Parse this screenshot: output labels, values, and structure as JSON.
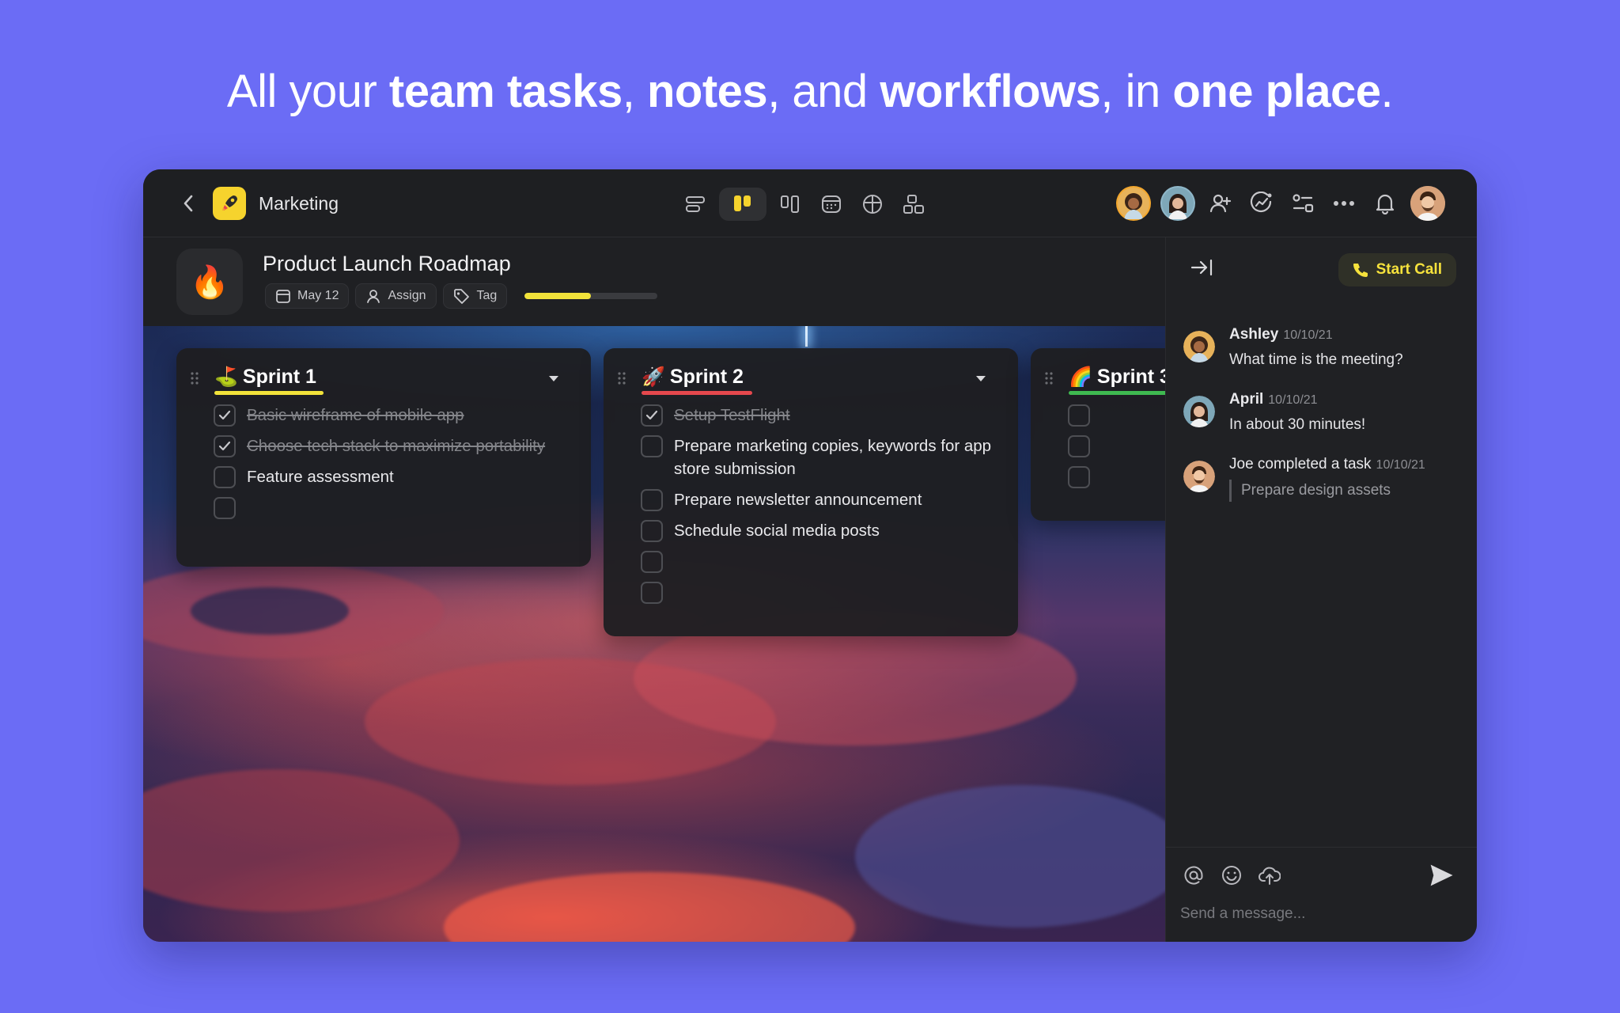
{
  "headline": {
    "p1": "All your ",
    "b1": "team tasks",
    "p2": ", ",
    "b2": "notes",
    "p3": ", and ",
    "b3": "workflows",
    "p4": ", in ",
    "b4": "one place",
    "p5": "."
  },
  "topbar": {
    "workspace": "Marketing",
    "app_icon": "rocket-icon",
    "views": [
      "list-view-icon",
      "board-view-icon",
      "columns-view-icon",
      "calendar-view-icon",
      "table-view-icon",
      "widgets-view-icon"
    ],
    "active_view": 1,
    "tools": [
      "add-member-icon",
      "activity-icon",
      "automations-icon",
      "more-icon",
      "bell-icon"
    ]
  },
  "project": {
    "emoji": "🔥",
    "title": "Product Launch Roadmap",
    "date": "May 12",
    "assign": "Assign",
    "tag": "Tag",
    "progress": 0.5,
    "progress_color": "#f2e33a"
  },
  "sprints": [
    {
      "emoji": "⛳",
      "title": "Sprint 1",
      "underline_color": "#f2e33a",
      "tasks": [
        {
          "text": "Basic wireframe of mobile app",
          "done": true
        },
        {
          "text": "Choose tech stack to maximize portability",
          "done": true
        },
        {
          "text": "Feature assessment",
          "done": false
        },
        {
          "text": "",
          "done": false
        }
      ]
    },
    {
      "emoji": "🚀",
      "title": "Sprint 2",
      "underline_color": "#e5484d",
      "tasks": [
        {
          "text": "Setup TestFlight",
          "done": true
        },
        {
          "text": "Prepare marketing copies, keywords for app store submission",
          "done": false
        },
        {
          "text": "Prepare newsletter announcement",
          "done": false
        },
        {
          "text": "Schedule social media posts",
          "done": false
        },
        {
          "text": "",
          "done": false
        },
        {
          "text": "",
          "done": false
        }
      ]
    },
    {
      "emoji": "🌈",
      "title": "Sprint 3",
      "underline_color": "#3fb950",
      "tasks": [
        {
          "text": "",
          "done": false
        },
        {
          "text": "",
          "done": false
        },
        {
          "text": "",
          "done": false
        }
      ]
    }
  ],
  "chat": {
    "start_call": "Start Call",
    "messages": [
      {
        "name": "Ashley",
        "time": "10/10/21",
        "text": "What time is the meeting?"
      },
      {
        "name": "April",
        "time": "10/10/21",
        "text": "In about 30 minutes!"
      },
      {
        "name": "Joe completed a task",
        "time": "10/10/21",
        "quote": "Prepare design assets"
      }
    ],
    "placeholder": "Send a message..."
  }
}
